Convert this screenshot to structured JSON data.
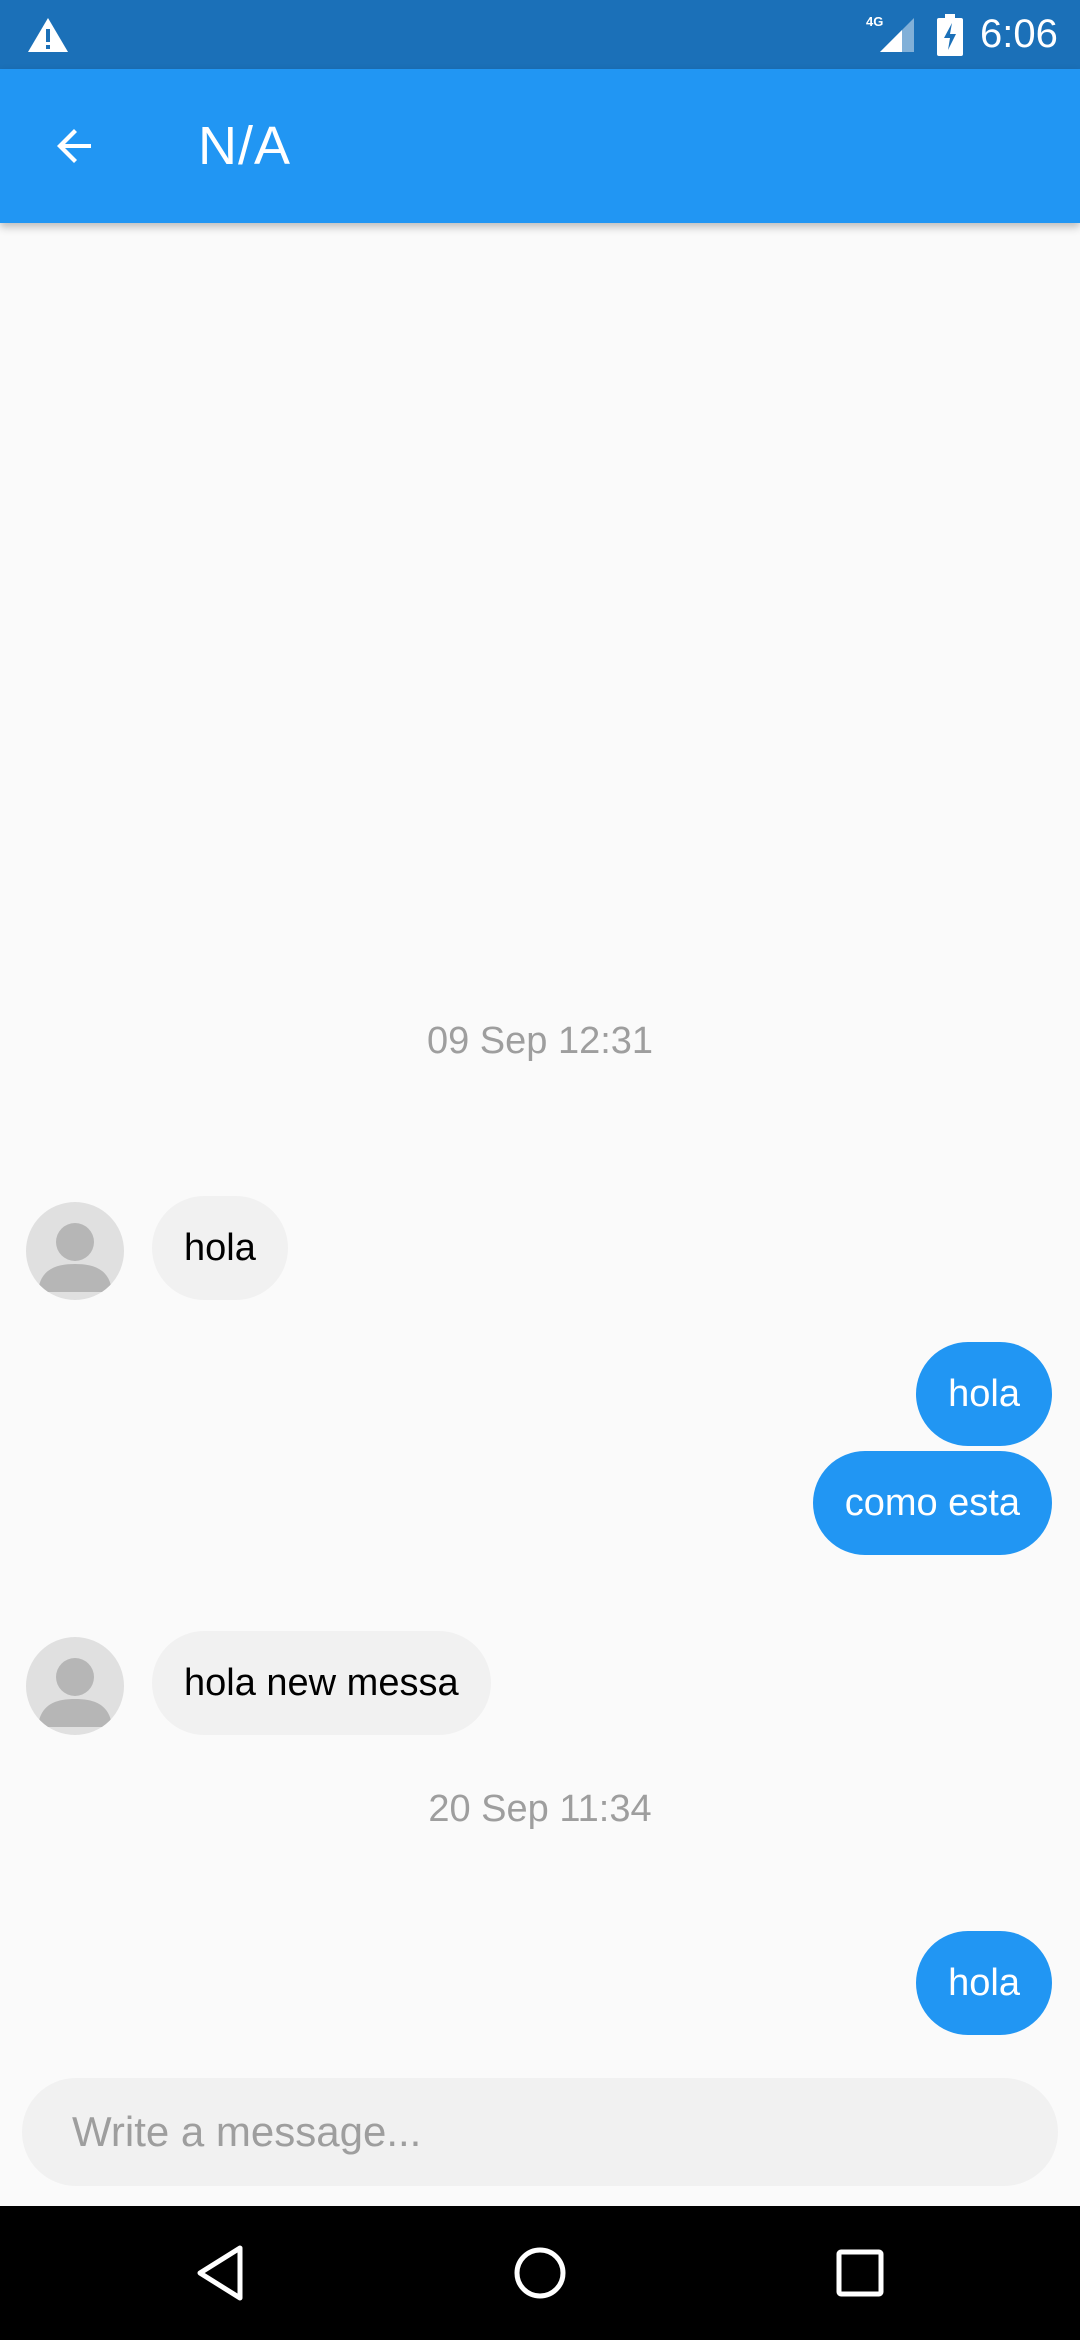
{
  "status_bar": {
    "time": "6:06",
    "network": "4G",
    "icons": [
      "warning-icon",
      "signal-icon",
      "battery-charging-icon"
    ]
  },
  "app_bar": {
    "title": "N/A",
    "back_icon": "arrow-back-icon",
    "color": "#2196f3"
  },
  "messages": [
    {
      "type": "date",
      "text": "09 Sep 12:31"
    },
    {
      "type": "incoming",
      "text": "hola"
    },
    {
      "type": "outgoing",
      "text": "hola"
    },
    {
      "type": "outgoing",
      "text": "como esta"
    },
    {
      "type": "incoming",
      "text": "hola new messa"
    },
    {
      "type": "date",
      "text": "20 Sep 11:34"
    },
    {
      "type": "outgoing",
      "text": "hola"
    }
  ],
  "composer": {
    "placeholder": "Write a message..."
  },
  "nav_bar": {
    "icons": [
      "back-triangle-icon",
      "home-circle-icon",
      "recents-square-icon"
    ]
  },
  "colors": {
    "status_bar": "#1b70b8",
    "accent": "#2196f3",
    "incoming_bubble": "#f1f1f1",
    "background": "#fafafa"
  }
}
